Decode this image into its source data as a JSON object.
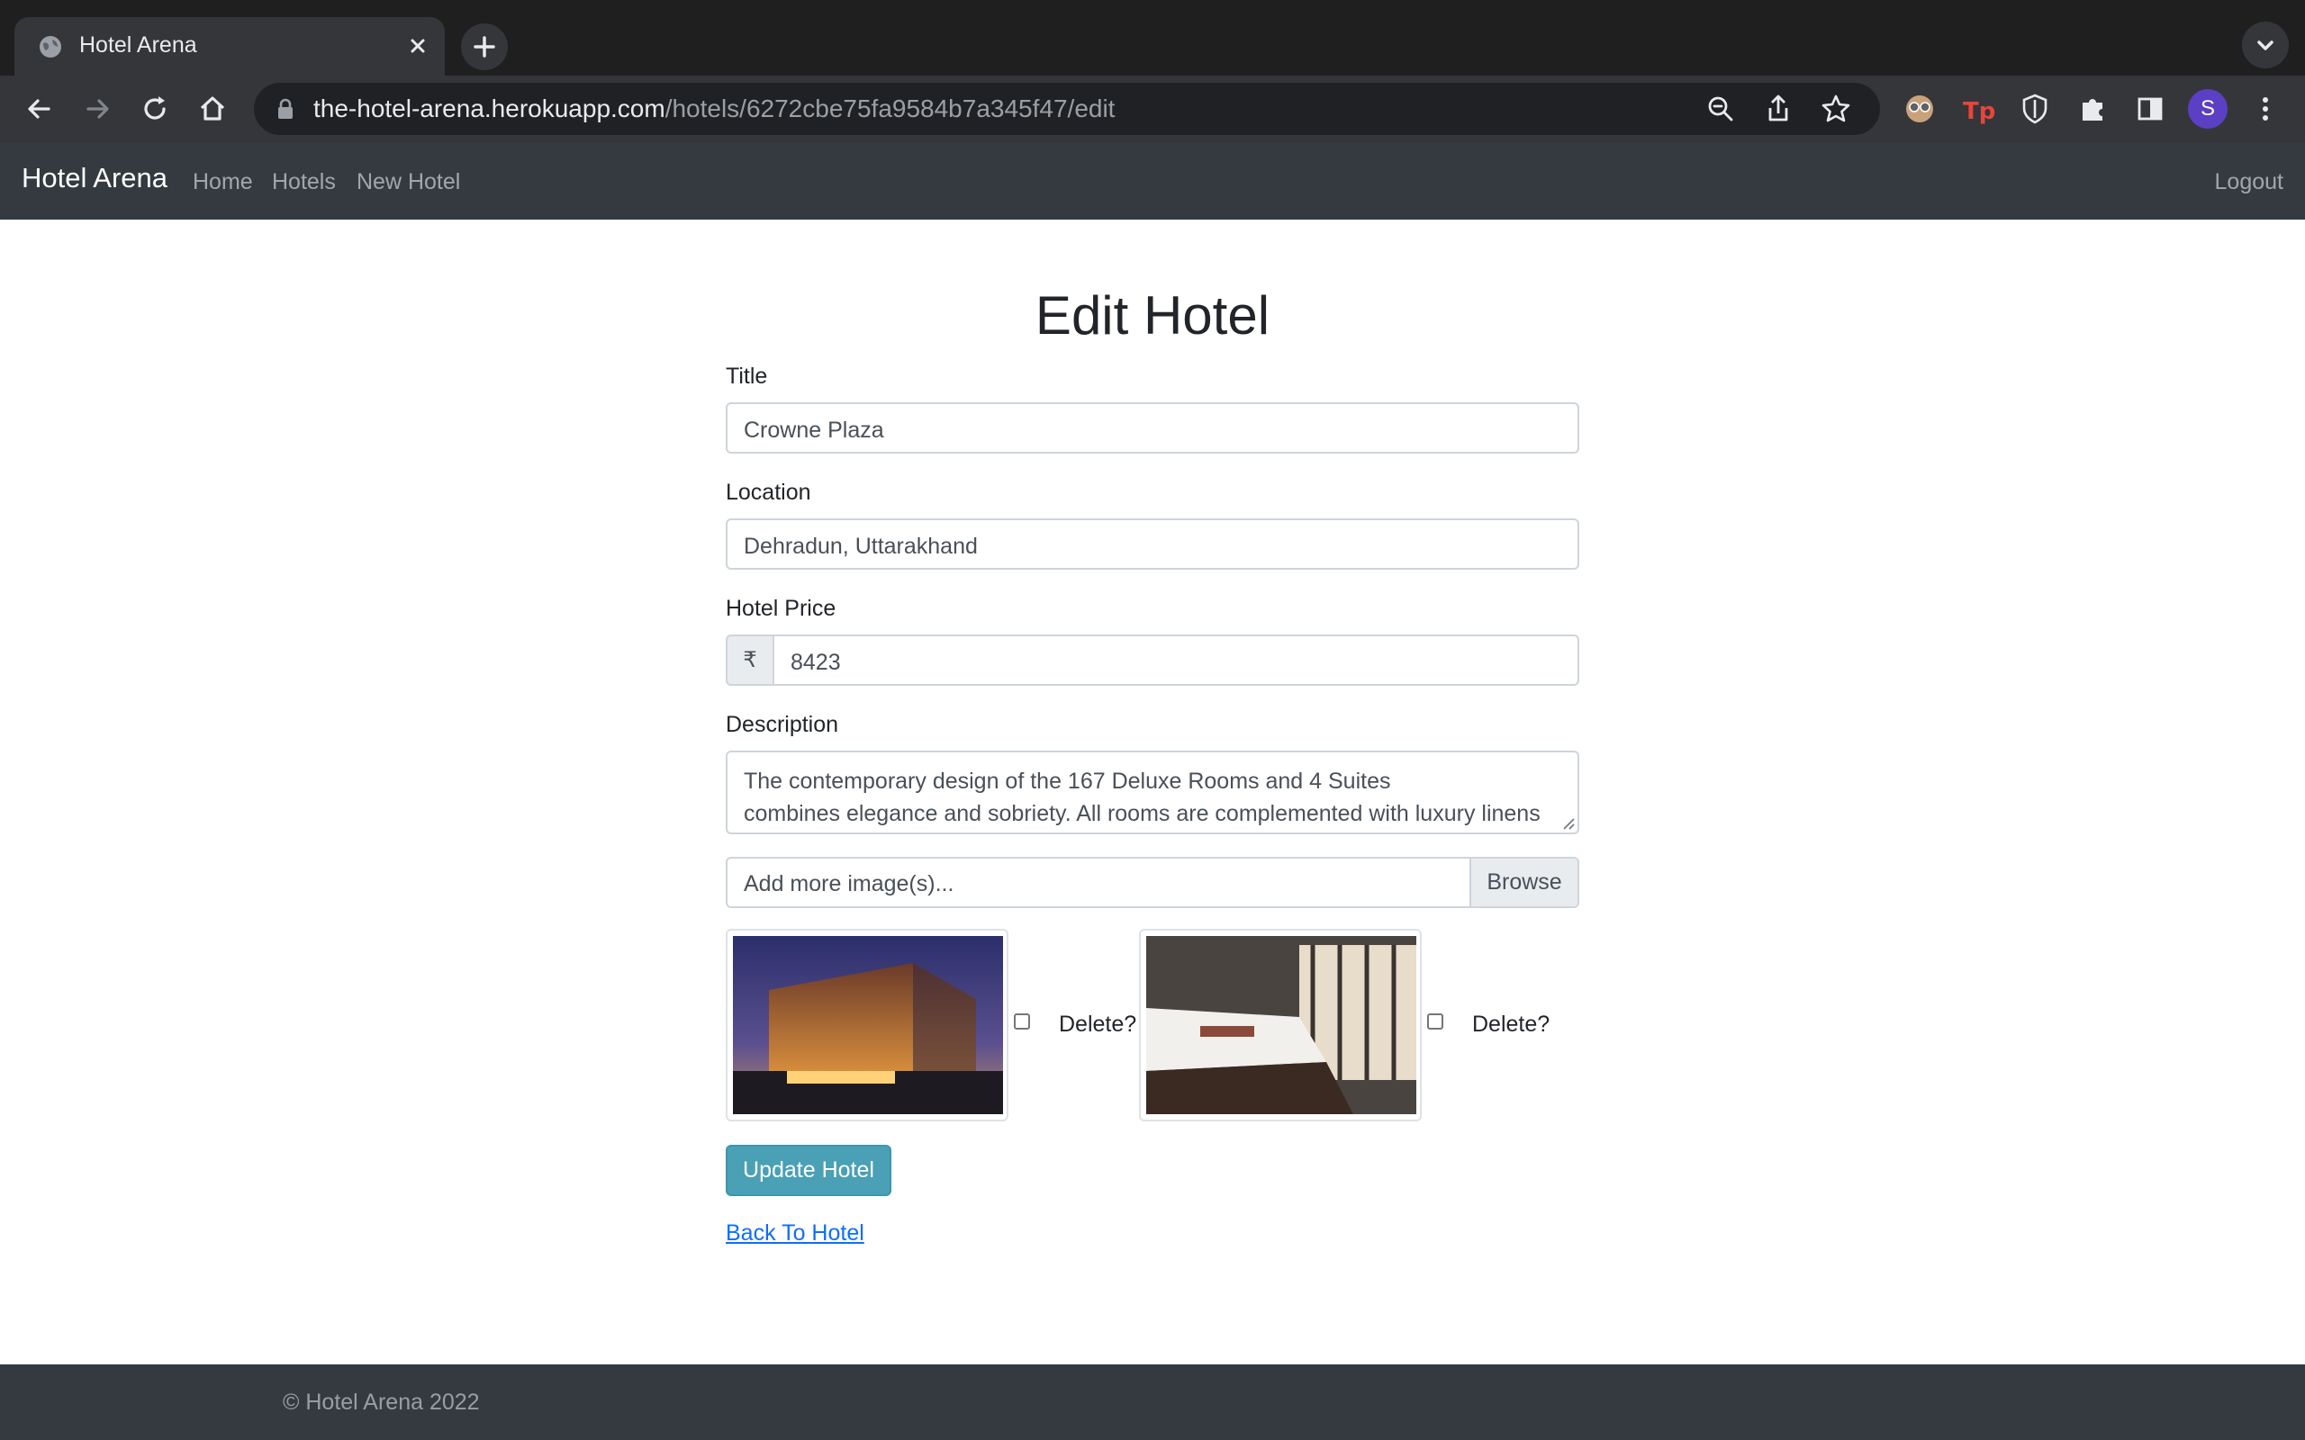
{
  "browser": {
    "tab_title": "Hotel Arena",
    "url_host": "the-hotel-arena.herokuapp.com",
    "url_path": "/hotels/6272cbe75fa9584b7a345f47/edit",
    "profile_initial": "S"
  },
  "navbar": {
    "brand": "Hotel Arena",
    "links": [
      "Home",
      "Hotels",
      "New Hotel"
    ],
    "logout": "Logout"
  },
  "form": {
    "heading": "Edit Hotel",
    "title_label": "Title",
    "title_value": "Crowne Plaza",
    "location_label": "Location",
    "location_value": "Dehradun, Uttarakhand",
    "price_label": "Hotel Price",
    "price_prefix": "₹",
    "price_value": "8423",
    "description_label": "Description",
    "description_line1": "The contemporary design of the 167 Deluxe Rooms and 4 Suites",
    "description_line2": "combines elegance and sobriety. All rooms are complemented with luxury linens",
    "file_placeholder": "Add more image(s)...",
    "browse_label": "Browse",
    "delete_label": "Delete?",
    "submit_label": "Update Hotel",
    "back_link": "Back To Hotel"
  },
  "footer": {
    "copyright": "© Hotel Arena 2022"
  },
  "colors": {
    "navbar_bg": "#343a40",
    "button_info": "#4aa0b5",
    "link": "#0d6efd"
  }
}
